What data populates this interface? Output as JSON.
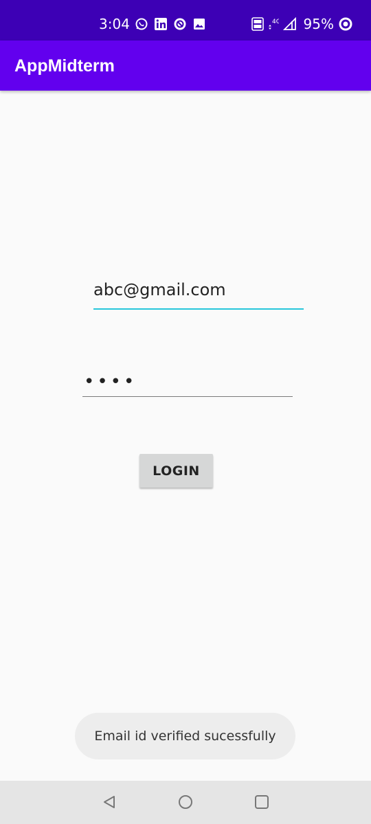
{
  "status_bar": {
    "time": "3:04",
    "left_icons": [
      "whatsapp-icon",
      "linkedin-icon",
      "notification-icon",
      "gallery-icon"
    ],
    "right_icons": [
      "volte-icon",
      "4g-data-icon",
      "signal-icon"
    ],
    "battery": "95%",
    "network": "4G",
    "volte": "Vo LTE"
  },
  "app_bar": {
    "title": "AppMidterm"
  },
  "form": {
    "email_value": "abc@gmail.com",
    "password_value": "••••"
  },
  "login_button": {
    "label": "LOGIN"
  },
  "toast": {
    "message": "Email id verified sucessfully"
  },
  "nav_bar": {
    "buttons": [
      "back",
      "home",
      "recents"
    ]
  },
  "colors": {
    "status_bar": "#3d00b5",
    "app_bar": "#6200ee",
    "email_underline": "#26c6da",
    "background": "#fafafa"
  }
}
